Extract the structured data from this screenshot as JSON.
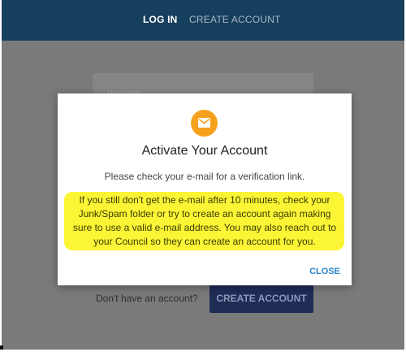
{
  "header": {
    "tabs": [
      {
        "label": "LOG IN",
        "active": true
      },
      {
        "label": "CREATE ACCOUNT",
        "active": false
      }
    ]
  },
  "login_form": {
    "username_label": "Username",
    "footer_prompt": "Don't have an account?",
    "create_button": "CREATE ACCOUNT"
  },
  "dialog": {
    "icon": "mail-icon",
    "title": "Activate Your Account",
    "subtitle": "Please check your e-mail for a verification link.",
    "body": "If you still don't get the e-mail after 10 minutes, check your Junk/Spam folder or try to create an account again making sure to use a valid e-mail address. You may also reach out to your Council so they can create an account for you.",
    "close_label": "CLOSE"
  },
  "colors": {
    "header_bg": "#163f5d",
    "icon_bg": "#f5a11c",
    "highlight": "#fbf535",
    "close_text": "#2a84c8",
    "button_bg": "#1f2c56"
  }
}
